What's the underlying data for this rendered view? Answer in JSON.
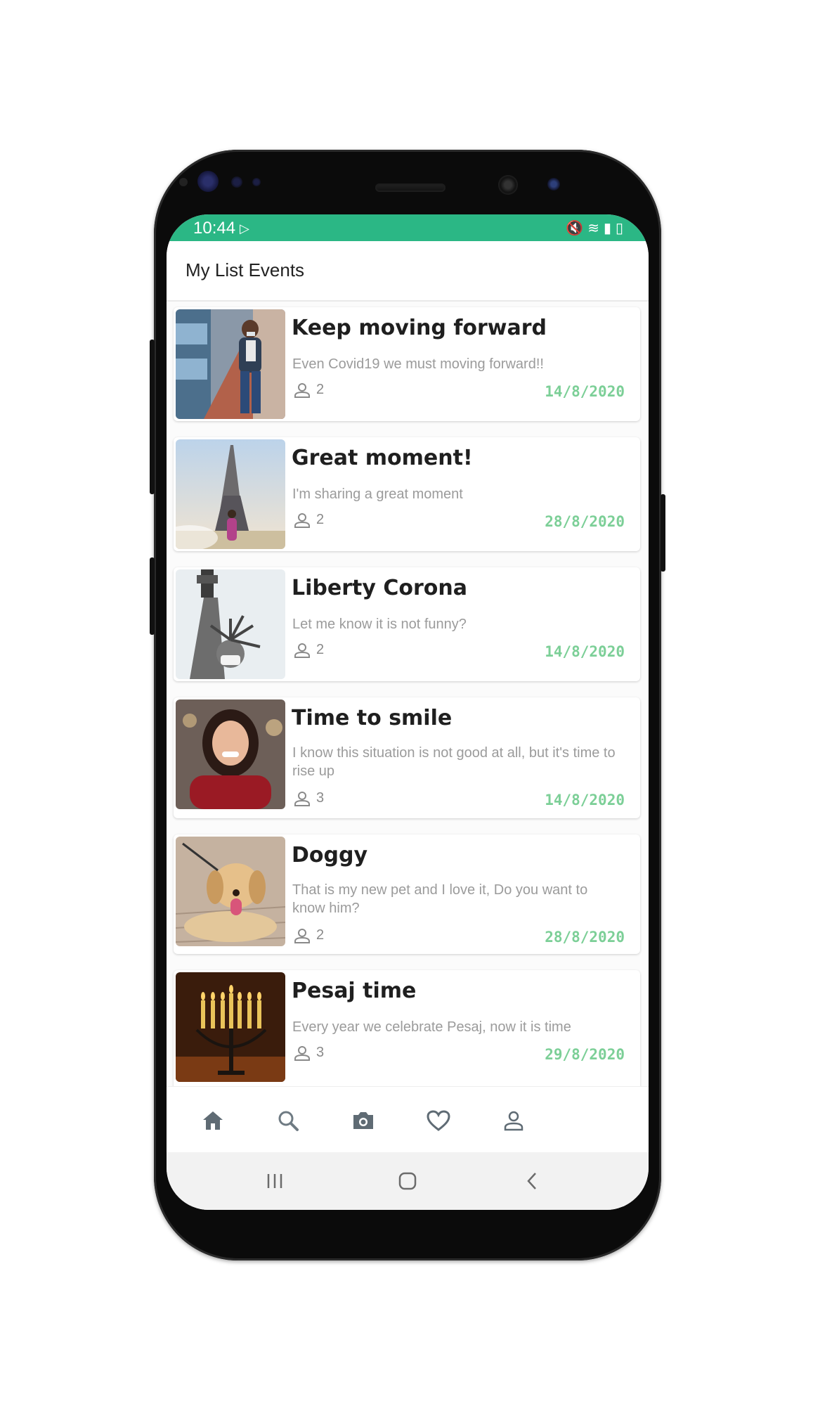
{
  "status_bar": {
    "time": "10:44",
    "play_icon": "play-store-icon",
    "right_icons": [
      "mute-icon",
      "wifi-icon",
      "signal-icon",
      "battery-icon"
    ],
    "color": "#2bb785"
  },
  "app_bar": {
    "title": "My List Events"
  },
  "events": [
    {
      "title": "Keep moving forward",
      "description": "Even Covid19 we must moving forward!!",
      "participants": "2",
      "date": "14/8/2020",
      "image": "woman-running-with-mask"
    },
    {
      "title": "Great moment!",
      "description": "I'm sharing a great moment",
      "participants": "2",
      "date": "28/8/2020",
      "image": "eiffel-tower"
    },
    {
      "title": "Liberty Corona",
      "description": "Let me know it is not funny?",
      "participants": "2",
      "date": "14/8/2020",
      "image": "statue-of-liberty-mask"
    },
    {
      "title": "Time to smile",
      "description": "I know this situation is not good at all, but it's time to rise up",
      "participants": "3",
      "date": "14/8/2020",
      "image": "smiling-woman"
    },
    {
      "title": "Doggy",
      "description": "That is my new pet and I love it, Do you want to know him?",
      "participants": "2",
      "date": "28/8/2020",
      "image": "golden-retriever-puppy"
    },
    {
      "title": "Pesaj time",
      "description": "Every year we celebrate Pesaj, now it is time",
      "participants": "3",
      "date": "29/8/2020",
      "image": "menorah-candles"
    }
  ],
  "bottom_nav": [
    "home-icon",
    "search-icon",
    "camera-icon",
    "heart-icon",
    "profile-icon"
  ],
  "system_nav": [
    "recent-apps-icon",
    "home-button-icon",
    "back-icon"
  ],
  "colors": {
    "accent": "#2bb785",
    "date": "#7ccf97"
  }
}
